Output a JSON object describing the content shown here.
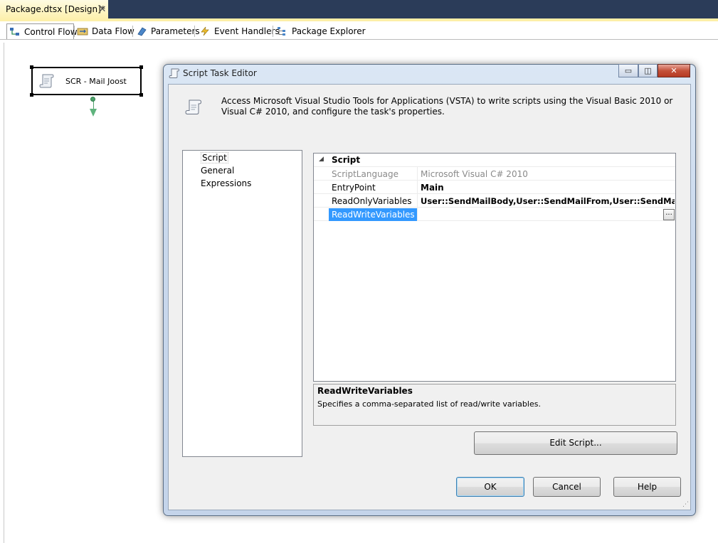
{
  "document_tab": {
    "title": "Package.dtsx [Design]*",
    "close_glyph": "✕"
  },
  "designer_tabs": [
    {
      "label": "Control Flow",
      "icon": "control-flow-icon"
    },
    {
      "label": "Data Flow",
      "icon": "data-flow-icon"
    },
    {
      "label": "Parameters",
      "icon": "parameters-icon"
    },
    {
      "label": "Event Handlers",
      "icon": "event-handlers-icon"
    },
    {
      "label": "Package Explorer",
      "icon": "package-explorer-icon"
    }
  ],
  "canvas": {
    "task": {
      "label": "SCR - Mail Joost",
      "icon": "script-scroll-icon"
    }
  },
  "dialog": {
    "title": "Script Task Editor",
    "caption_buttons": {
      "minimize": "▭",
      "maximize": "◫",
      "close": "✕"
    },
    "description": "Access Microsoft Visual Studio Tools for Applications (VSTA) to write scripts using the Visual Basic 2010 or Visual C# 2010, and configure the task's properties.",
    "nav_items": [
      "Script",
      "General",
      "Expressions"
    ],
    "property_grid": {
      "category": "Script",
      "toggle_glyph": "◢",
      "rows": [
        {
          "name": "ScriptLanguage",
          "value": "Microsoft Visual C# 2010",
          "readonly": true
        },
        {
          "name": "EntryPoint",
          "value": "Main",
          "bold": true
        },
        {
          "name": "ReadOnlyVariables",
          "value": "User::SendMailBody,User::SendMailFrom,User::SendMailSubject,",
          "bold": true
        },
        {
          "name": "ReadWriteVariables",
          "value": "",
          "selected": true
        }
      ],
      "ellipsis_label": "..."
    },
    "help": {
      "title": "ReadWriteVariables",
      "text": "Specifies a comma-separated list of read/write variables."
    },
    "buttons": {
      "edit_script": "Edit Script...",
      "ok": "OK",
      "cancel": "Cancel",
      "help": "Help"
    },
    "grip_glyph": "⋰"
  },
  "colors": {
    "tabstrip_bg": "#2b3c59",
    "active_tab": "#fdefa7",
    "selection": "#3399ff",
    "connector": "#4ea16b"
  }
}
